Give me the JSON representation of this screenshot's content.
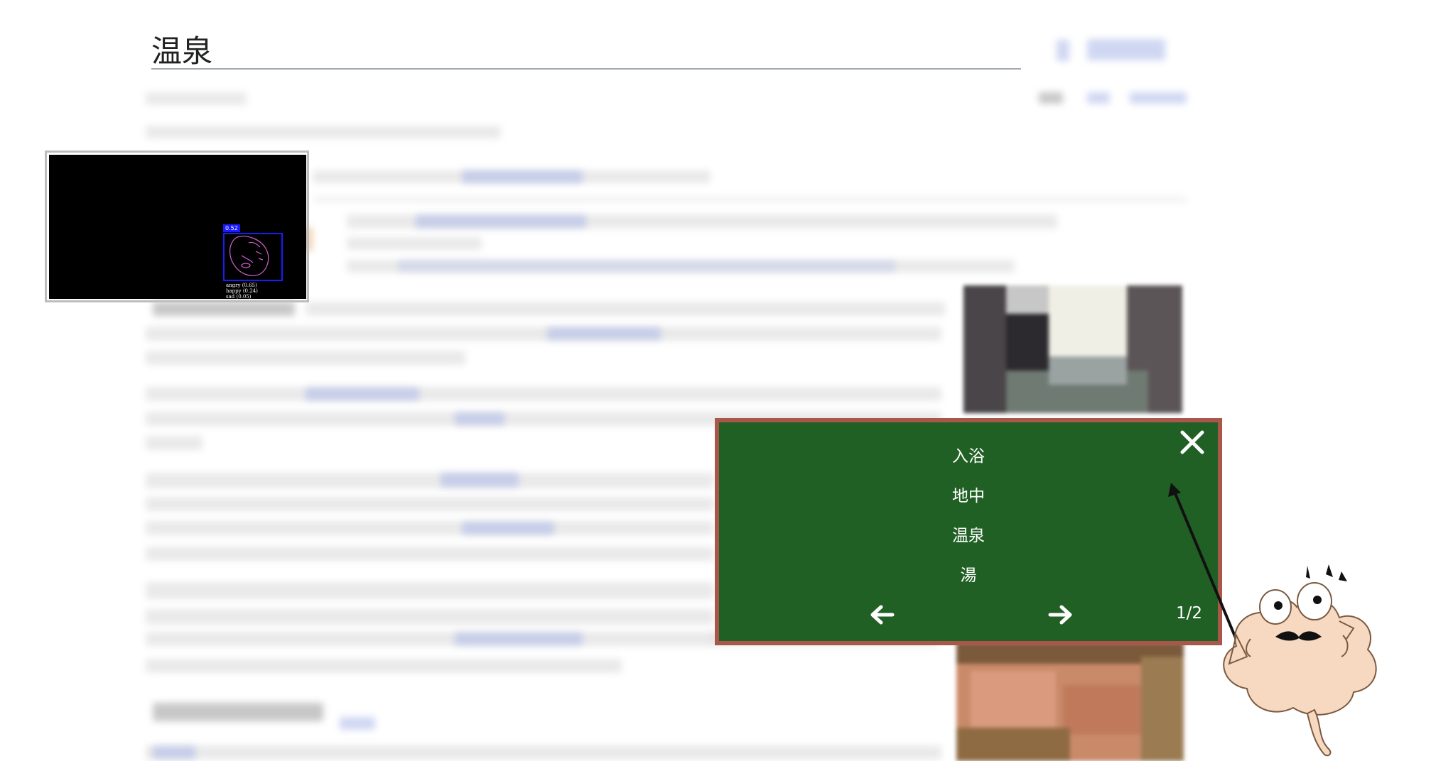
{
  "article": {
    "title": "温泉"
  },
  "webcam": {
    "face_score": "0.52",
    "emotions": [
      "angry (0.65)",
      "happy (0.24)",
      "sad (0.05)"
    ]
  },
  "vocab_card": {
    "words": [
      "入浴",
      "地中",
      "温泉",
      "湯"
    ],
    "page_indicator": "1/2"
  },
  "icons": {
    "close": "close-icon",
    "prev": "arrow-left-icon",
    "next": "arrow-right-icon",
    "mascot": "brain-mascot-icon"
  },
  "colors": {
    "board": "#216024",
    "board_border": "#a8574a",
    "face_box": "#1a1aff"
  }
}
